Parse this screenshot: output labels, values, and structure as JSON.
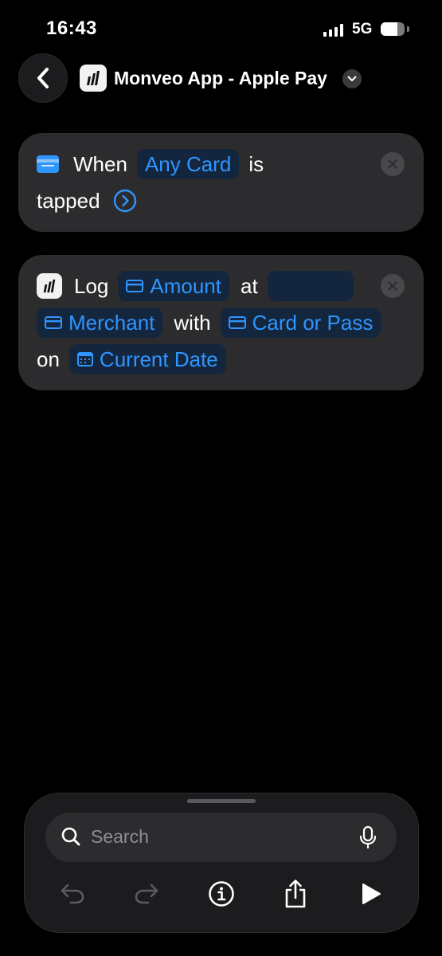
{
  "status_bar": {
    "time": "16:43",
    "network": "5G",
    "battery_level": 0.7
  },
  "header": {
    "title": "Monveo App - Apple Pay"
  },
  "trigger_card": {
    "word_when": "When",
    "token_any_card": "Any Card",
    "word_is": "is",
    "word_tapped": "tapped"
  },
  "action_card": {
    "word_log": "Log",
    "token_amount": "Amount",
    "word_at": "at",
    "token_merchant": "Merchant",
    "word_with": "with",
    "token_card_or_pass": "Card or Pass",
    "word_on": "on",
    "token_current_date": "Current Date"
  },
  "bottom_panel": {
    "search_placeholder": "Search"
  },
  "colors": {
    "accent": "#2f95ff",
    "token_bg": "#13263d",
    "card_bg": "#2c2c2e"
  }
}
